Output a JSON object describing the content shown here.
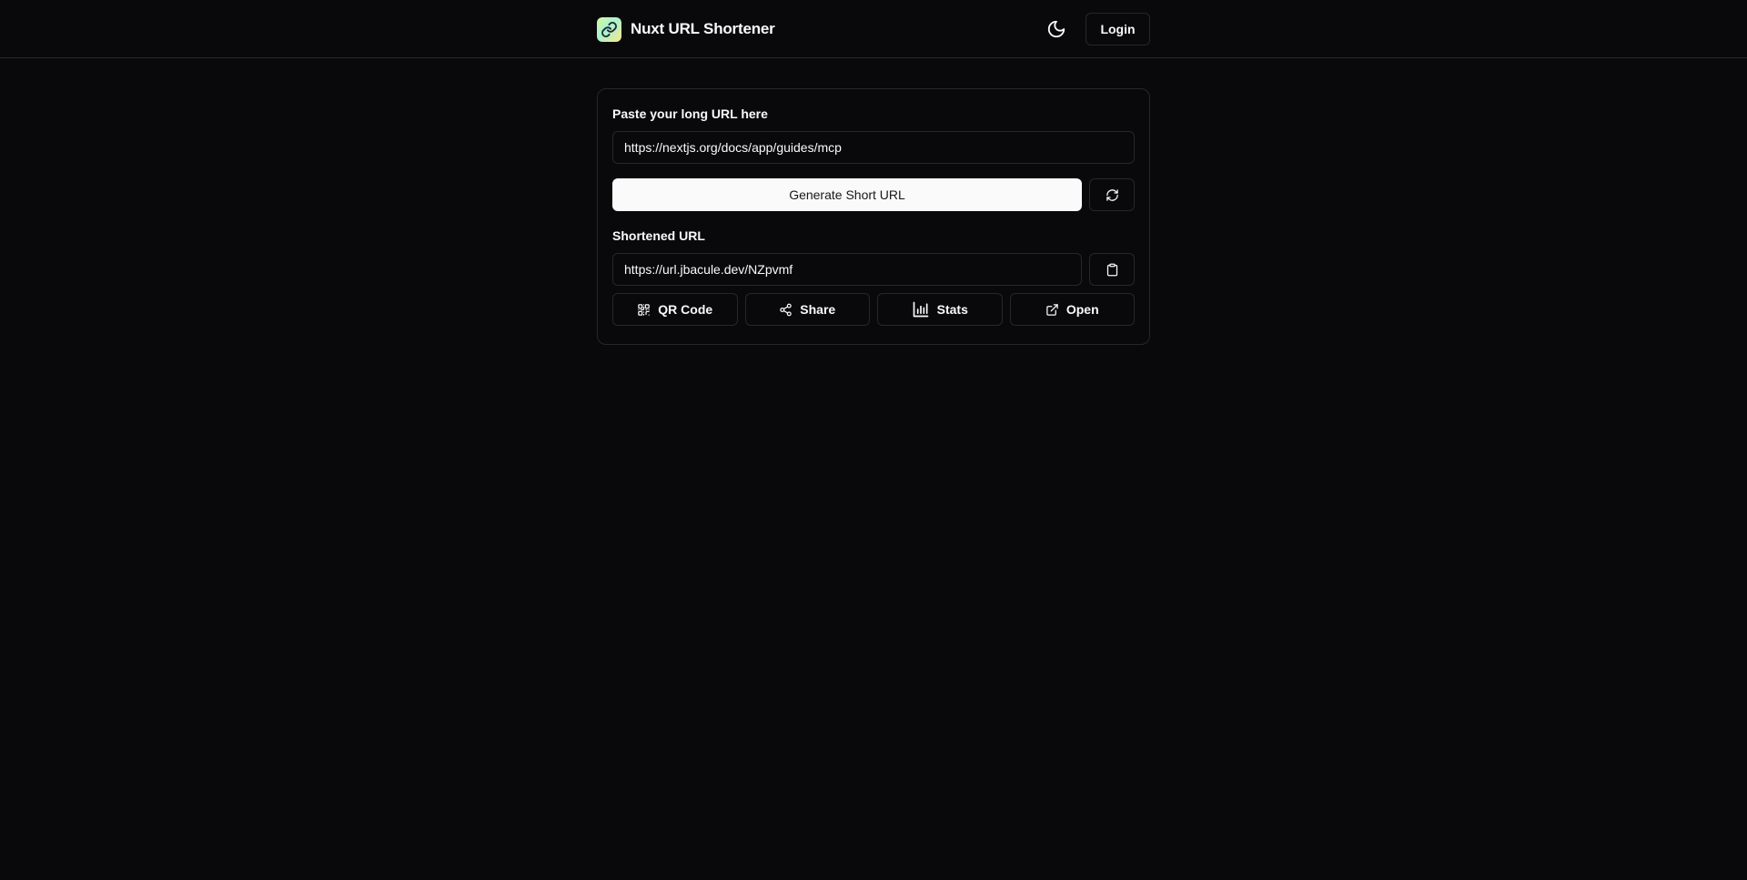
{
  "header": {
    "brand_name": "Nuxt URL Shortener",
    "logo_icon": "link-logo-icon",
    "theme_icon": "moon-icon",
    "login_label": "Login"
  },
  "form": {
    "long_url_label": "Paste your long URL here",
    "long_url_value": "https://nextjs.org/docs/app/guides/mcp",
    "generate_label": "Generate Short URL",
    "reset_icon": "refresh-icon",
    "short_url_label": "Shortened URL",
    "short_url_value": "https://url.jbacule.dev/NZpvmf",
    "copy_icon": "clipboard-icon"
  },
  "actions": [
    {
      "label": "QR Code",
      "icon": "qr-code-icon"
    },
    {
      "label": "Share",
      "icon": "share-icon"
    },
    {
      "label": "Stats",
      "icon": "bar-chart-icon"
    },
    {
      "label": "Open",
      "icon": "external-link-icon"
    }
  ],
  "colors": {
    "background": "#09090b",
    "border": "#27272a",
    "foreground": "#fafafa",
    "primary_button": "#fafafa"
  }
}
